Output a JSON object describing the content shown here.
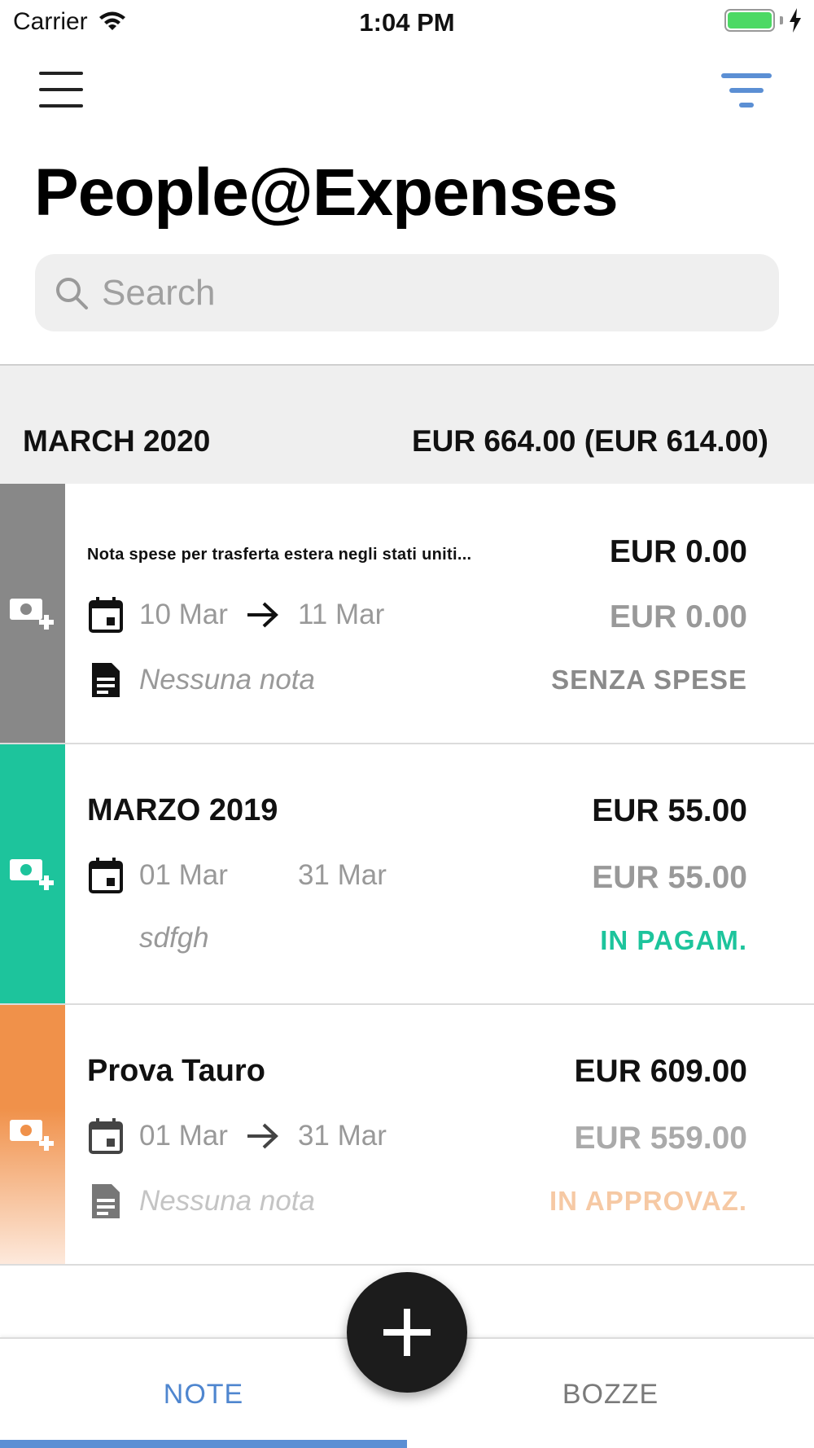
{
  "status_bar": {
    "carrier": "Carrier",
    "time": "1:04 PM",
    "battery_color": "#4cd964"
  },
  "header": {
    "title": "People@Expenses",
    "menu_icon": "hamburger-menu-icon",
    "filter_icon": "filter-icon",
    "accent_color": "#5b8fd4"
  },
  "search": {
    "placeholder": "Search",
    "value": ""
  },
  "section": {
    "month": "MARCH 2020",
    "total": "EUR 664.00 (EUR 614.00)"
  },
  "expenses": [
    {
      "title": "Nota spese per trasferta estera negli stati uniti...",
      "amount": "EUR 0.00",
      "start_date": "10 Mar",
      "end_date": "11 Mar",
      "amount_approved": "EUR 0.00",
      "note": "Nessuna nota",
      "status": "SENZA SPESE",
      "strip_color": "#888888",
      "status_color": "#8a8a8a"
    },
    {
      "title": "MARZO 2019",
      "amount": "EUR 55.00",
      "start_date": "01 Mar",
      "end_date": "31 Mar",
      "amount_approved": "EUR 55.00",
      "note": "sdfgh",
      "status": "IN PAGAM.",
      "strip_color": "#1dc49c",
      "status_color": "#1dc49c"
    },
    {
      "title": "Prova Tauro",
      "amount": "EUR 609.00",
      "start_date": "01 Mar",
      "end_date": "31 Mar",
      "amount_approved": "EUR 559.00",
      "note": "Nessuna nota",
      "status": "IN APPROVAZ.",
      "strip_color": "#f0914a",
      "status_color": "#f6c9a4"
    }
  ],
  "tabs": [
    {
      "label": "NOTE",
      "active": true
    },
    {
      "label": "BOZZE",
      "active": false
    }
  ],
  "fab": {
    "icon": "plus-icon"
  }
}
